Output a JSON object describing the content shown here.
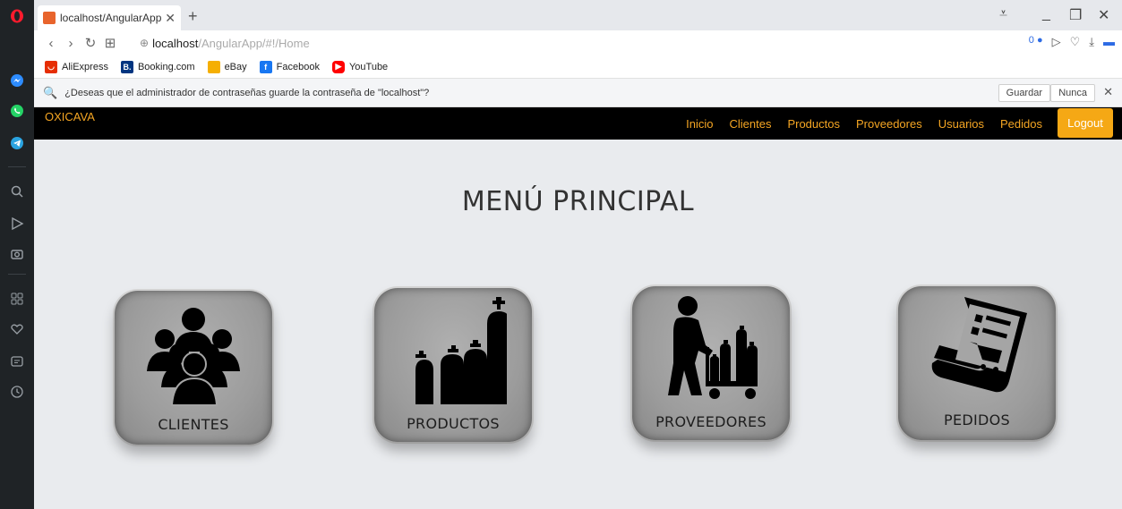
{
  "browser": {
    "tab_title": "localhost/AngularApp/#!/",
    "url_host": "localhost",
    "url_path": "/AngularApp/#!/Home",
    "bookmarks": [
      {
        "label": "AliExpress",
        "color": "#e62e04",
        "icon": "aliexpress-icon"
      },
      {
        "label": "Booking.com",
        "color": "#003580",
        "icon": "booking-icon"
      },
      {
        "label": "eBay",
        "color": "#f5af02",
        "icon": "ebay-icon"
      },
      {
        "label": "Facebook",
        "color": "#1877f2",
        "icon": "facebook-icon"
      },
      {
        "label": "YouTube",
        "color": "#ff0000",
        "icon": "youtube-icon"
      }
    ],
    "password_prompt": "¿Deseas que el administrador de contraseñas guarde la contraseña de \"localhost\"?",
    "password_save": "Guardar",
    "password_never": "Nunca",
    "vpn_badge": "0"
  },
  "navbar": {
    "brand": "OXICAVA",
    "links": [
      "Inicio",
      "Clientes",
      "Productos",
      "Proveedores",
      "Usuarios",
      "Pedidos"
    ],
    "logout": "Logout",
    "accent": "#f5a623"
  },
  "main": {
    "title": "MENÚ PRINCIPAL",
    "cards": [
      {
        "label": "CLIENTES",
        "icon": "users-group-icon"
      },
      {
        "label": "PRODUCTOS",
        "icon": "gas-cylinders-icon"
      },
      {
        "label": "PROVEEDORES",
        "icon": "worker-cart-icon"
      },
      {
        "label": "PEDIDOS",
        "icon": "order-receipt-icon"
      }
    ]
  }
}
